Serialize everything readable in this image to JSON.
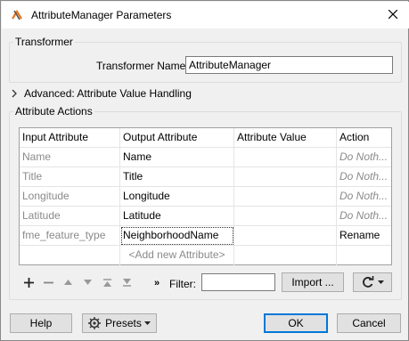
{
  "window": {
    "title": "AttributeManager Parameters"
  },
  "transformer_group": {
    "label": "Transformer",
    "name_label": "Transformer Name:",
    "name_value": "AttributeManager"
  },
  "advanced": {
    "label": "Advanced: Attribute Value Handling"
  },
  "actions_group": {
    "label": "Attribute Actions"
  },
  "table": {
    "headers": [
      "Input Attribute",
      "Output Attribute",
      "Attribute Value",
      "Action"
    ],
    "rows": [
      {
        "input": "Name",
        "output": "Name",
        "value": "",
        "action": "Do Noth..."
      },
      {
        "input": "Title",
        "output": "Title",
        "value": "",
        "action": "Do Noth..."
      },
      {
        "input": "Longitude",
        "output": "Longitude",
        "value": "",
        "action": "Do Noth..."
      },
      {
        "input": "Latitude",
        "output": "Latitude",
        "value": "",
        "action": "Do Noth..."
      },
      {
        "input": "fme_feature_type",
        "output": "NeighborhoodName",
        "value": "",
        "action": "Rename"
      }
    ],
    "add_new": "<Add new Attribute>"
  },
  "toolbar": {
    "filter_label": "Filter:",
    "filter_icon": "»",
    "filter_value": "",
    "import_label": "Import ..."
  },
  "footer": {
    "help": "Help",
    "presets": "Presets",
    "ok": "OK",
    "cancel": "Cancel"
  },
  "icons": [
    "app-icon",
    "close-icon",
    "chevron-right-icon",
    "add-icon",
    "remove-icon",
    "move-up-icon",
    "move-down-icon",
    "move-top-icon",
    "move-bottom-icon",
    "filter-expand-icon",
    "refresh-icon",
    "dropdown-arrow-icon",
    "presets-gear-icon"
  ]
}
